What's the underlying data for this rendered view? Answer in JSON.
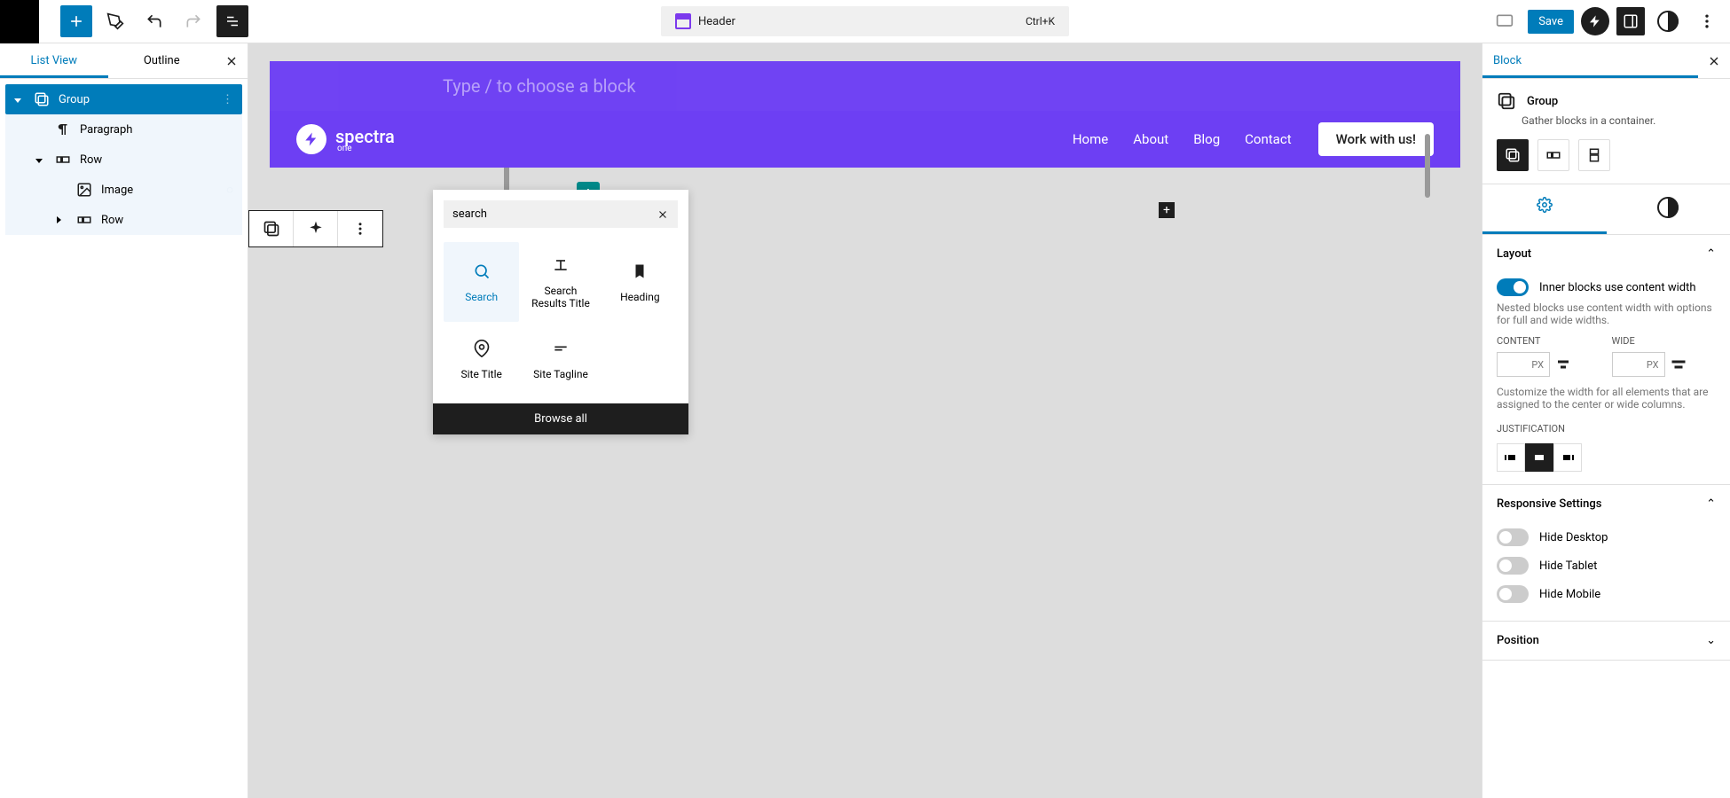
{
  "topbar": {
    "title": "Header",
    "shortcut": "Ctrl+K",
    "save": "Save"
  },
  "leftPanel": {
    "tabs": {
      "listView": "List View",
      "outline": "Outline"
    },
    "tree": {
      "group": "Group",
      "paragraph": "Paragraph",
      "row1": "Row",
      "image": "Image",
      "row2": "Row"
    }
  },
  "canvas": {
    "placeholder": "Type / to choose a block",
    "brand": "spectra",
    "brandSub": "one",
    "nav": {
      "home": "Home",
      "about": "About",
      "blog": "Blog",
      "contact": "Contact"
    },
    "cta": "Work with us!"
  },
  "inserter": {
    "searchValue": "search",
    "items": {
      "search": "Search",
      "searchResults": "Search Results Title",
      "heading": "Heading",
      "siteTitle": "Site Title",
      "siteTagline": "Site Tagline"
    },
    "browseAll": "Browse all"
  },
  "rightPanel": {
    "tab": "Block",
    "blockTitle": "Group",
    "blockDesc": "Gather blocks in a container.",
    "layout": {
      "title": "Layout",
      "innerBlocks": "Inner blocks use content width",
      "helper1": "Nested blocks use content width with options for full and wide widths.",
      "content": "CONTENT",
      "wide": "WIDE",
      "unit": "PX",
      "helper2": "Customize the width for all elements that are assigned to the center or wide columns.",
      "justification": "JUSTIFICATION"
    },
    "responsive": {
      "title": "Responsive Settings",
      "hideDesktop": "Hide Desktop",
      "hideTablet": "Hide Tablet",
      "hideMobile": "Hide Mobile"
    },
    "position": "Position"
  }
}
